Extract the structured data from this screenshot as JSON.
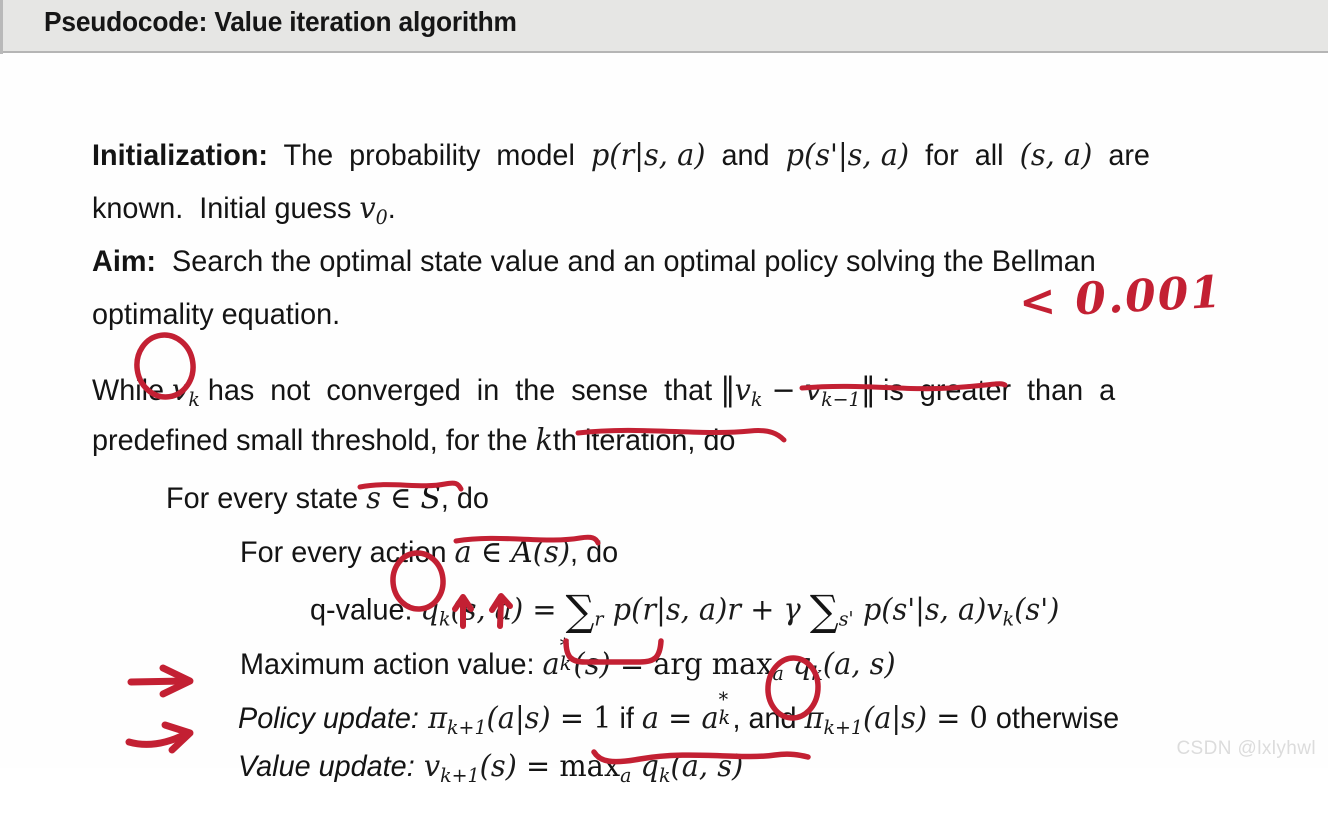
{
  "header": {
    "title": "Pseudocode: Value iteration algorithm"
  },
  "body": {
    "initialization_label": "Initialization:",
    "initialization_text_1": "  The  probability  model  ",
    "initialization_math_p_r": "p(r|s, a)",
    "initialization_text_2": "  and  ",
    "initialization_math_p_s": "p(s'|s, a)",
    "initialization_text_3": "  for  all  ",
    "initialization_math_sa": "(s, a)",
    "initialization_text_4": "  are",
    "initialization_line2_a": "known.  Initial guess ",
    "initialization_line2_v0": "v",
    "initialization_line2_v0sub": "0",
    "initialization_line2_b": ".",
    "aim_label": "Aim:",
    "aim_text_1": "  Search the optimal state value and an optimal policy solving the Bellman",
    "aim_line2": "optimality equation.",
    "while_text_1": "While ",
    "while_vk": "v",
    "while_vk_sub": "k",
    "while_text_2": " has  not  converged  in  the  sense  that ",
    "while_norm_open": "‖",
    "while_norm_vk": "v",
    "while_norm_vk_sub": "k",
    "while_norm_minus": " − ",
    "while_norm_vk1": "v",
    "while_norm_vk1_sub": "k−1",
    "while_norm_close": "‖",
    "while_text_3": " is  greater  than  a",
    "while_line2_a": "predefined small threshold, for the ",
    "while_line2_k": "k",
    "while_line2_b": "th iteration, do",
    "for_state_a": "For every state ",
    "for_state_s": "s",
    "for_state_in": " ∈ ",
    "for_state_S": "S",
    "for_state_b": ", do",
    "for_action_a": "For every action ",
    "for_action_act": "a",
    "for_action_in": " ∈ ",
    "for_action_A": "A",
    "for_action_paren": "(s)",
    "for_action_b": ", do",
    "qvalue_label": "q-value: ",
    "qvalue_q": "q",
    "qvalue_q_sub": "k",
    "qvalue_args": "(s, a)",
    "qvalue_eq": " = ",
    "qvalue_sum1": "∑",
    "qvalue_sum1_sub": "r",
    "qvalue_term1": " p(r|s, a)r",
    "qvalue_plus": " + ",
    "qvalue_gamma": "γ ",
    "qvalue_sum2": "∑",
    "qvalue_sum2_sub": "s'",
    "qvalue_term2": " p(s'|s, a)",
    "qvalue_vk": "v",
    "qvalue_vk_sub": "k",
    "qvalue_vk_args": "(s')",
    "maxaction_label": "Maximum action value: ",
    "maxaction_a": "a",
    "maxaction_star": "*",
    "maxaction_k": "k",
    "maxaction_s": "(s)",
    "maxaction_eq": " = ",
    "maxaction_argmax": "arg max",
    "maxaction_argmax_sub": "a",
    "maxaction_q": " q",
    "maxaction_q_sub": "k",
    "maxaction_q_args": "(a, s)",
    "policy_label": "Policy update:",
    "policy_pi": " π",
    "policy_pi_sub": "k+1",
    "policy_args": "(a|s)",
    "policy_eq1": " = ",
    "policy_one": "1",
    "policy_if": " if ",
    "policy_a": "a",
    "policy_eq2": " = ",
    "policy_astar_a": "a",
    "policy_astar_star": "*",
    "policy_astar_k": "k",
    "policy_and": ", and ",
    "policy_pi2": "π",
    "policy_pi2_sub": "k+1",
    "policy_args2": "(a|s)",
    "policy_eq3": " = ",
    "policy_zero": "0",
    "policy_otherwise": " otherwise",
    "value_label": "Value update:",
    "value_v": " v",
    "value_v_sub": "k+1",
    "value_args": "(s)",
    "value_eq": " = ",
    "value_max": "max",
    "value_max_sub": "a",
    "value_q": " q",
    "value_q_sub": "k",
    "value_q_args": "(a, s)"
  },
  "annotations": {
    "handwritten_threshold": "< 0.001",
    "ink_color": "#c32033",
    "marks": [
      {
        "name": "circle-vk",
        "kind": "ellipse"
      },
      {
        "name": "underline-norm-vk",
        "kind": "wavy-underline"
      },
      {
        "name": "underline-kth-iteration",
        "kind": "wavy-underline"
      },
      {
        "name": "underline-s-in-S",
        "kind": "wavy-underline"
      },
      {
        "name": "underline-a-in-A",
        "kind": "wavy-underline"
      },
      {
        "name": "circle-qk",
        "kind": "ellipse"
      },
      {
        "name": "arrow-up-s",
        "kind": "arrow-up"
      },
      {
        "name": "arrow-up-a",
        "kind": "arrow-up"
      },
      {
        "name": "underbrace-astar",
        "kind": "underbrace"
      },
      {
        "name": "circle-astar",
        "kind": "ellipse"
      },
      {
        "name": "arrow-policy-update",
        "kind": "arrow-right"
      },
      {
        "name": "arrow-value-update",
        "kind": "arrow-right"
      },
      {
        "name": "underline-max-qk",
        "kind": "wavy-underline"
      }
    ]
  },
  "watermark": {
    "text": "CSDN @lxlyhwl"
  }
}
